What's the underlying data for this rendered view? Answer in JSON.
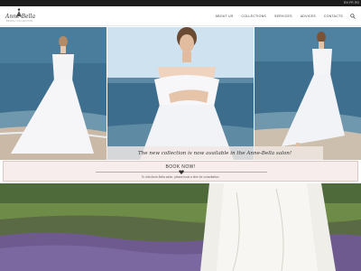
{
  "topbar": {
    "languages": [
      "EN",
      "FR",
      "RO"
    ]
  },
  "header": {
    "logo_text": "Anne-Bella",
    "logo_tagline": "BRIDAL COLLECTION",
    "nav": [
      "ABOUT US",
      "COLLECTIONS",
      "SERVICES",
      "ADVICES",
      "CONTACTS"
    ],
    "search_icon": "search-icon"
  },
  "hero": {
    "caption": "The new collection is now available in the Anne-Bella salon!"
  },
  "booking": {
    "title": "BOOK NOW!",
    "heart_icon": "heart-icon",
    "subtitle": "To visit Anne-Bella salon, please book a time for consultation."
  },
  "colors": {
    "topbar": "#1c1c1c",
    "booking_bg": "#f7edec",
    "booking_border": "#d9c9c6",
    "sea": "#3f6f8e",
    "sky": "#cfe2f0",
    "lavender": "#6f5a8f"
  }
}
